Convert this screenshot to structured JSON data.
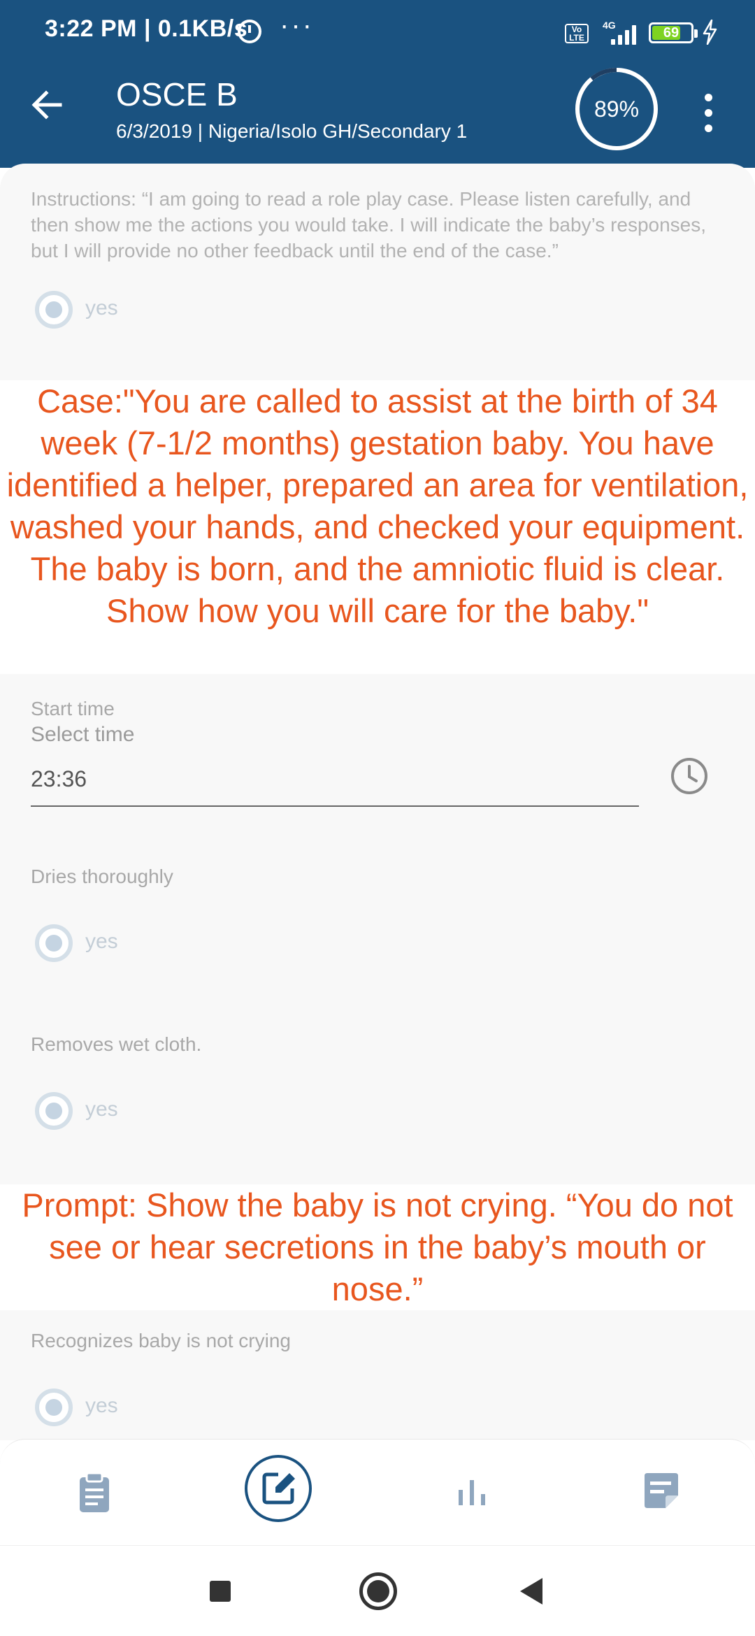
{
  "status_bar": {
    "time": "3:22 PM | 0.1KB/s",
    "alarm_icon": "alarm-icon",
    "more_dots": "···",
    "volte": "Vo LTE",
    "network": "4G",
    "battery": "69",
    "charging_icon": "bolt-icon"
  },
  "app_bar": {
    "back_icon": "arrow-left-icon",
    "title": "OSCE B",
    "subtitle": "6/3/2019 | Nigeria/Isolo GH/Secondary 1",
    "progress_label": "89%",
    "progress_value": 0.89,
    "menu_icon": "more-vert-icon"
  },
  "form": {
    "instructions": "Instructions: “I am going to read a role play case. Please listen carefully, and then show me the actions you would take. I will indicate the baby’s responses, but I will provide no other feedback until the end of the case.”",
    "instructions_answer": "yes",
    "case_text": "Case:\"You are called to assist at the birth of 34 week (7-1/2 months) gestation baby. You have identified a helper, prepared an area for ventilation, washed your hands, and checked your equipment. The baby is born, and the amniotic fluid is clear. Show how you will care for the baby.\"",
    "start_time": {
      "label": "Start time",
      "title": "Select time",
      "value": "23:36"
    },
    "items": [
      {
        "label": "Dries thoroughly",
        "answer": "yes"
      },
      {
        "label": "Removes wet cloth.",
        "answer": "yes"
      }
    ],
    "prompt_text": "Prompt: Show the baby is not crying. “You do not see or hear secretions in the baby’s mouth or nose.”",
    "items2": [
      {
        "label": "Recognizes baby is not crying",
        "answer": "yes"
      }
    ]
  },
  "bottom_nav": [
    {
      "icon": "clipboard-icon",
      "active": false
    },
    {
      "icon": "edit-icon",
      "active": true
    },
    {
      "icon": "bar-chart-icon",
      "active": false
    },
    {
      "icon": "note-icon",
      "active": false
    }
  ],
  "colors": {
    "primary": "#1a5280",
    "callout": "#e8561e",
    "radio": "#c5d4e2",
    "background": "#f8f8f8"
  }
}
